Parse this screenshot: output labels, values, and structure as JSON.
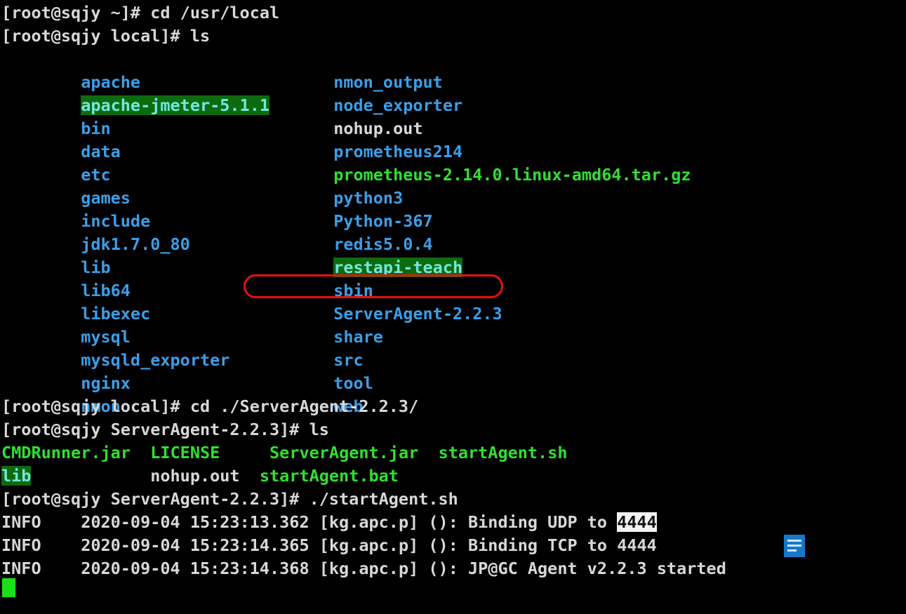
{
  "terminal": {
    "hostname": "sqjy",
    "user": "root",
    "background_color": "#000000",
    "colors": {
      "text": "#d8d8d8",
      "directory": "#3b9ee8",
      "archive": "#2fe02f",
      "executable": "#2fe02f",
      "setgid_bg": "#0d6b0d",
      "setgid_fg": "#6fe8e0",
      "cursor": "#16e016",
      "annotation": "#e81010",
      "selection_bg": "#f2f2f2",
      "selection_fg": "#101010"
    }
  },
  "prompts": {
    "p1": "[root@sqjy ~]# cd /usr/local",
    "p2": "[root@sqjy local]# ls",
    "p3": "[root@sqjy local]# cd ./ServerAgent-2.2.3/",
    "p4": "[root@sqjy ServerAgent-2.2.3]# ls",
    "p5": "[root@sqjy ServerAgent-2.2.3]# ./startAgent.sh"
  },
  "listing_local": {
    "rows": [
      {
        "left": "apache",
        "left_type": "dir",
        "right": "nmon_output",
        "right_type": "dir"
      },
      {
        "left": "apache-jmeter-5.1.1",
        "left_type": "setgid",
        "right": "node_exporter",
        "right_type": "dir"
      },
      {
        "left": "bin",
        "left_type": "dir",
        "right": "nohup.out",
        "right_type": "file"
      },
      {
        "left": "data",
        "left_type": "dir",
        "right": "prometheus214",
        "right_type": "dir"
      },
      {
        "left": "etc",
        "left_type": "dir",
        "right": "prometheus-2.14.0.linux-amd64.tar.gz",
        "right_type": "archive"
      },
      {
        "left": "games",
        "left_type": "dir",
        "right": "python3",
        "right_type": "dir"
      },
      {
        "left": "include",
        "left_type": "dir",
        "right": "Python-367",
        "right_type": "dir"
      },
      {
        "left": "jdk1.7.0_80",
        "left_type": "dir",
        "right": "redis5.0.4",
        "right_type": "dir"
      },
      {
        "left": "lib",
        "left_type": "dir",
        "right": "restapi-teach",
        "right_type": "setgid"
      },
      {
        "left": "lib64",
        "left_type": "dir",
        "right": "sbin",
        "right_type": "dir"
      },
      {
        "left": "libexec",
        "left_type": "dir",
        "right": "ServerAgent-2.2.3",
        "right_type": "dir"
      },
      {
        "left": "mysql",
        "left_type": "dir",
        "right": "share",
        "right_type": "dir"
      },
      {
        "left": "mysqld_exporter",
        "left_type": "dir",
        "right": "src",
        "right_type": "dir"
      },
      {
        "left": "nginx",
        "left_type": "dir",
        "right": "tool",
        "right_type": "dir"
      },
      {
        "left": "nmon",
        "left_type": "dir",
        "right": "web",
        "right_type": "dir"
      }
    ]
  },
  "listing_agent": {
    "line1": {
      "a": "CMDRunner.jar",
      "a_gap": "  ",
      "b": "LICENSE",
      "b_gap": "     ",
      "c": "ServerAgent.jar",
      "c_gap": "  ",
      "d": "startAgent.sh"
    },
    "line2": {
      "a": "lib",
      "a_gap": "            ",
      "b": "nohup.out",
      "b_gap": "  ",
      "c": "startAgent.bat"
    }
  },
  "log_lines": [
    {
      "level": "INFO",
      "gap1": "    ",
      "date": "2020-09-04",
      "time": "15:23:13.362",
      "logger": "[kg.apc.p]",
      "message": "(): Binding UDP to ",
      "value": "4444",
      "value_selected": true
    },
    {
      "level": "INFO",
      "gap1": "    ",
      "date": "2020-09-04",
      "time": "15:23:14.365",
      "logger": "[kg.apc.p]",
      "message": "(): Binding TCP to ",
      "value": "4444",
      "value_selected": false
    },
    {
      "level": "INFO",
      "gap1": "    ",
      "date": "2020-09-04",
      "time": "15:23:14.368",
      "logger": "[kg.apc.p]",
      "message": "(): JP@GC Agent v2.2.3 started",
      "value": "",
      "value_selected": false
    }
  ],
  "annotation": {
    "shape": "rounded-rectangle",
    "target": "ServerAgent-2.2.3",
    "color": "#e81010"
  }
}
